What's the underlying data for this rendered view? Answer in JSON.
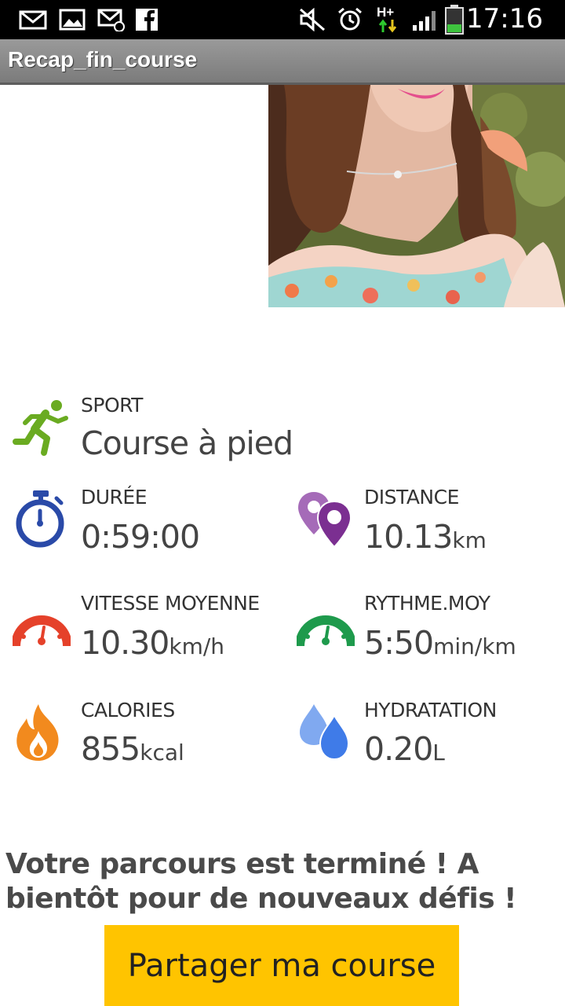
{
  "status_bar": {
    "time": "17:16",
    "network_type": "H+",
    "icons": [
      "mail-icon",
      "image-icon",
      "email-at-icon",
      "facebook-icon",
      "mute-icon",
      "alarm-icon",
      "data-arrows-icon",
      "signal-icon",
      "battery-icon"
    ]
  },
  "app": {
    "title": "Recap_fin_course"
  },
  "sport": {
    "label": "SPORT",
    "value": "Course à pied"
  },
  "stats": {
    "duration": {
      "label": "DURÉE",
      "value": "0:59:00"
    },
    "distance": {
      "label": "DISTANCE",
      "value": "10.13",
      "unit": "km"
    },
    "avg_speed": {
      "label": "VITESSE MOYENNE",
      "value": "10.30",
      "unit": "km/h"
    },
    "avg_pace": {
      "label": "RYTHME.MOY",
      "value": "5:50",
      "unit": "min/km"
    },
    "calories": {
      "label": "CALORIES",
      "value": "855",
      "unit": "kcal"
    },
    "hydration": {
      "label": "HYDRATATION",
      "value": "0.20",
      "unit": "L"
    }
  },
  "message": "Votre parcours est terminé ! A bientôt pour de nouveaux défis !",
  "share_button": {
    "label": "Partager ma course"
  },
  "colors": {
    "sport_green": "#6aab21",
    "stopwatch_blue": "#2a4aa8",
    "distance_purple": "#7b2f91",
    "speed_red": "#e5412a",
    "pace_green": "#1e9a4c",
    "calories_orange": "#f28a1e",
    "hydration_blue": "#3f7be8",
    "share_yellow": "#ffc400"
  }
}
